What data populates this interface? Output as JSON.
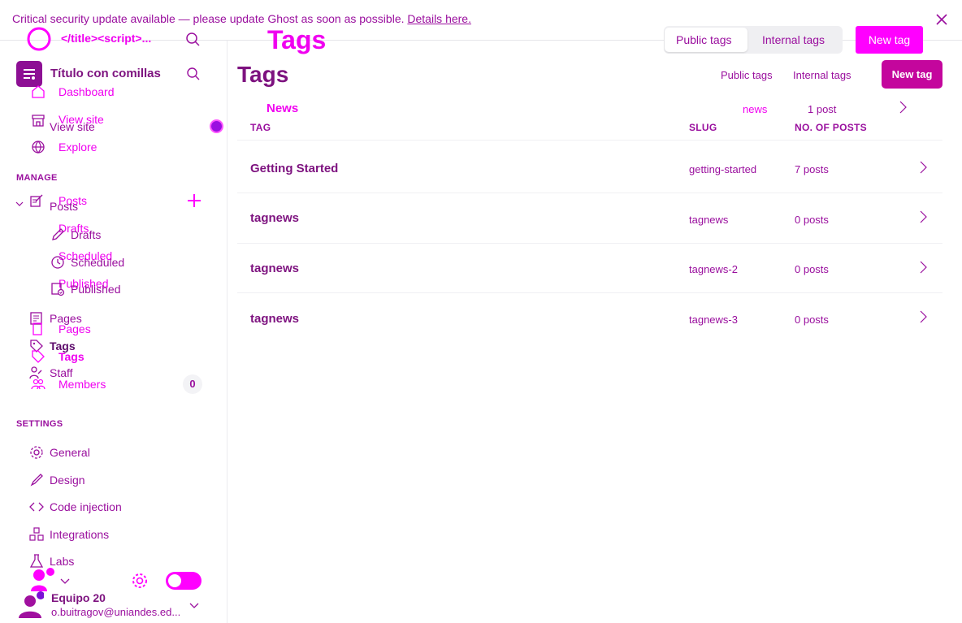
{
  "banner": {
    "message": "Critical security update available — please update Ghost as soon as possible.",
    "link": "Details here."
  },
  "site": {
    "title_ghost": "</title><script>...",
    "title": "Título con comillas"
  },
  "ghost_header": {
    "title": "Tags",
    "tab_public": "Public tags",
    "tab_internal": "Internal tags",
    "new_tag": "New tag"
  },
  "sidebar": {
    "ghost_items": {
      "dashboard": "Dashboard",
      "view_site": "View site",
      "explore": "Explore",
      "posts": "Posts",
      "drafts": "Drafts",
      "scheduled": "Scheduled",
      "published": "Published",
      "pages": "Pages",
      "tags": "Tags",
      "members": "Members",
      "members_count": "0"
    },
    "items": {
      "view_site": "View site",
      "manage": "MANAGE",
      "posts": "Posts",
      "drafts": "Drafts",
      "scheduled": "Scheduled",
      "published": "Published",
      "pages": "Pages",
      "tags": "Tags",
      "staff": "Staff",
      "settings": "SETTINGS",
      "general": "General",
      "design": "Design",
      "code_injection": "Code injection",
      "integrations": "Integrations",
      "labs": "Labs"
    },
    "user": {
      "name": "Equipo 20",
      "email": "o.buitragov@uniandes.ed..."
    }
  },
  "main": {
    "title": "Tags",
    "tab_public": "Public tags",
    "tab_internal": "Internal tags",
    "new_tag": "New tag",
    "ghost_row": {
      "name": "News",
      "slug": "news",
      "count": "1 post"
    },
    "columns": {
      "tag": "TAG",
      "slug": "SLUG",
      "posts": "NO. OF POSTS"
    },
    "rows": [
      {
        "name": "Getting Started",
        "slug": "getting-started",
        "count": "7 posts"
      },
      {
        "name": "tagnews",
        "slug": "tagnews",
        "count": "0 posts"
      },
      {
        "name": "tagnews",
        "slug": "tagnews-2",
        "count": "0 posts"
      },
      {
        "name": "tagnews",
        "slug": "tagnews-3",
        "count": "0 posts"
      }
    ]
  },
  "colors": {
    "accent": "#9a0f9e",
    "magenta": "#ff00ff",
    "button": "#c4069d"
  }
}
